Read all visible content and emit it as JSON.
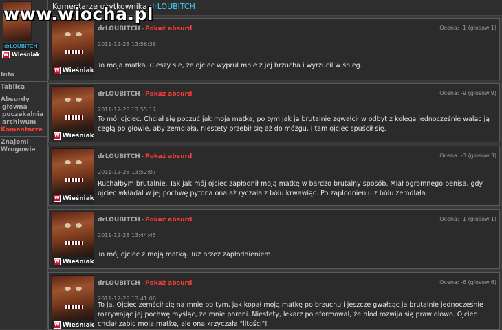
{
  "watermark": "www.wiocha.pl",
  "header": {
    "prefix": "Komentarze użytkownika",
    "username": "drLOUBITCH"
  },
  "profile": {
    "name": "drLOUBITCH",
    "rank": "Wieśniak"
  },
  "menu": {
    "info": "Info",
    "tablica": "Tablica",
    "absurdy": "Absurdy",
    "glowna": "główna",
    "poczekalnia": "poczekalnia",
    "archiwum": "archiwum",
    "komentarze": "Komentarze",
    "znajomi": "Znajomi",
    "wrogowie": "Wrogowie"
  },
  "comments": [
    {
      "author": "drLOUBITCH",
      "action": "Pokaż absurd",
      "date": "2011-12-28 13:56:36",
      "score": "Ocena: -1 (glosow:1)",
      "rank": "Wieśniak",
      "text": "To moja matka. Cieszy sie, że ojciec wyprul mnie z jej brzucha i wyrzucil w śnieg."
    },
    {
      "author": "drLOUBITCH",
      "action": "Pokaż absurd",
      "date": "2011-12-28 13:55:17",
      "score": "Ocena: -9 (glosow:9)",
      "rank": "Wieśniak",
      "text": "To mój ojciec. Chciał się poczuć jak moja matka, po tym jak ją brutalnie zgwałcił w odbyt z kolegą jednocześnie waląc ją cegłą po głowie, aby zemdlała, niestety przebił się aż do mózgu, i tam ojciec spuścił się."
    },
    {
      "author": "drLOUBITCH",
      "action": "Pokaż absurd",
      "date": "2011-12-28 13:52:07",
      "score": "Ocena: -3 (glosow:3)",
      "rank": "Wieśniak",
      "text": "Ruchałbym brutalnie. Tak jak mój ojciec zapłodnił moją matkę w bardzo brutalny sposób. Miał ogromnego penisa, gdy ojciec wkładał w jej pochwę pytona ona aż ryczała z bólu krwawiąc. Po zapłodnieniu z bólu zemdlała."
    },
    {
      "author": "drLOUBITCH",
      "action": "Pokaż absurd",
      "date": "2011-12-28 13:44:45",
      "score": "Ocena: -1 (glosow:1)",
      "rank": "Wieśniak",
      "text": "To mój ojciec z moją matką. Tuż przez zapłodnieniem."
    },
    {
      "author": "drLOUBITCH",
      "action": "Pokaż absurd",
      "date": "2011-12-28 13:41:00",
      "score": "Ocena: -6 (glosow:6)",
      "rank": "Wieśniak",
      "text": "To ja. Ojciec zemścił się na mnie po tym, jak kopał moją matkę po brzuchu i jeszcze gwałcąc ja brutalnie jednocześnie rozrywając jej pochwę myśląc, że mnie poroni. Niestety, lekarz poinformował, że płód rozwija się prawidłowo. Ojciec chciał zabic moja matkę, ale ona krzyczała \"litości\"!"
    }
  ]
}
